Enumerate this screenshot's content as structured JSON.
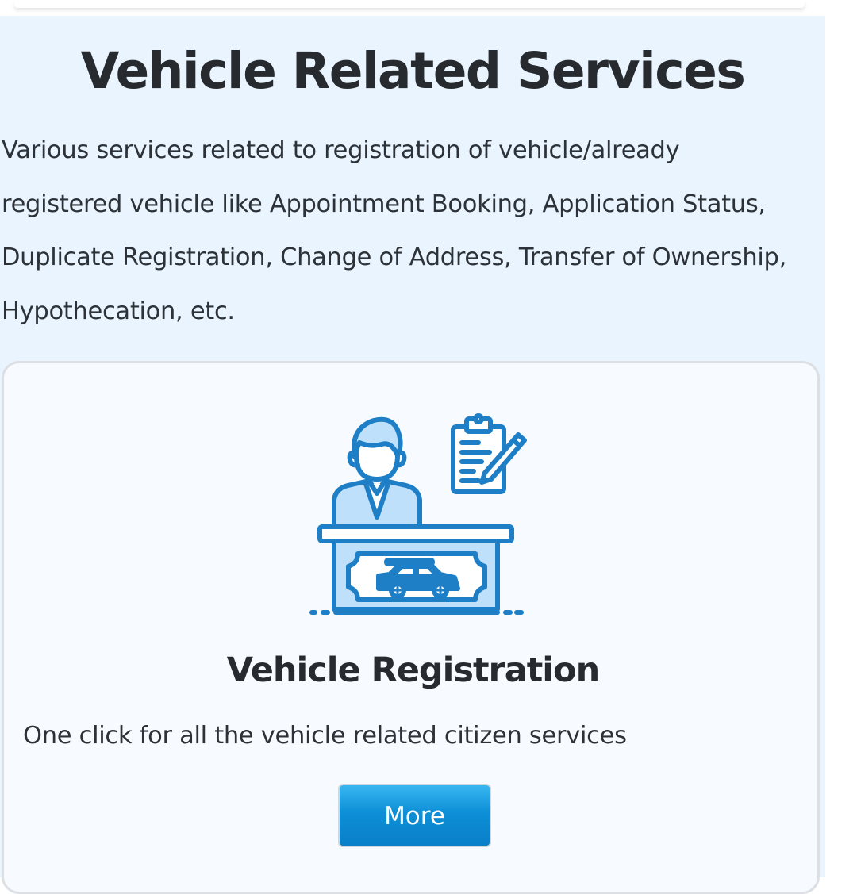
{
  "section": {
    "title": "Vehicle Related Services",
    "description_lines": [
      "Various services related to registration of vehicle/already",
      "registered vehicle like Appointment Booking, Application Status,",
      "Duplicate Registration, Change of Address, Transfer of Ownership,",
      "Hypothecation, etc."
    ]
  },
  "card": {
    "icon": "vehicle-registration-illustration",
    "title": "Vehicle Registration",
    "description": "One click for all the vehicle related citizen services",
    "button_label": "More"
  },
  "colors": {
    "section_background": "#e9f4fe",
    "card_background": "#f7fbff",
    "heading_text": "#272b30",
    "icon_stroke": "#1f7fc6",
    "icon_fill": "#bfe0fb",
    "button": "#0d8fd6"
  }
}
